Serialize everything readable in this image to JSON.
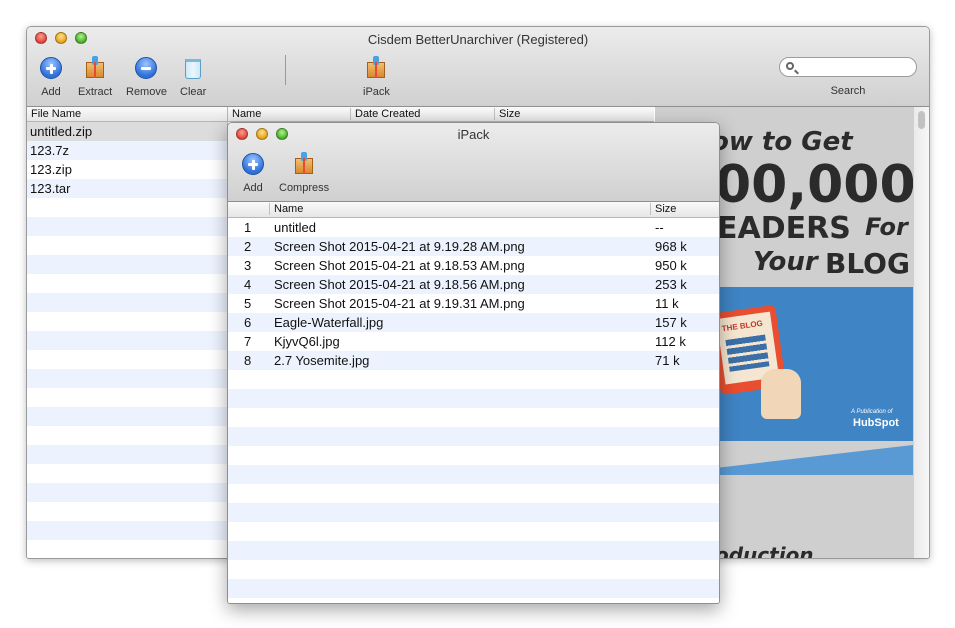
{
  "main_window": {
    "title": "Cisdem BetterUnarchiver (Registered)",
    "toolbar": {
      "add_label": "Add",
      "extract_label": "Extract",
      "remove_label": "Remove",
      "clear_label": "Clear",
      "ipack_label": "iPack",
      "search_label": "Search",
      "search_value": ""
    },
    "file_list": {
      "header": "File Name",
      "items": [
        "untitled.zip",
        "123.7z",
        "123.zip",
        "123.tar"
      ],
      "selected_index": 0
    },
    "contents_columns": [
      "Name",
      "Date Created",
      "Size"
    ],
    "preview": {
      "lines": [
        "ow to Get",
        "00,000",
        "EADERS",
        "For",
        "Your",
        "BLOG",
        "THE BLOG",
        "A Publication of",
        "HubSpot",
        "oduction"
      ]
    }
  },
  "ipack_window": {
    "title": "iPack",
    "toolbar": {
      "add_label": "Add",
      "compress_label": "Compress"
    },
    "columns": {
      "name": "Name",
      "size": "Size"
    },
    "rows": [
      {
        "index": "1",
        "name": "untitled",
        "size": "--"
      },
      {
        "index": "2",
        "name": "Screen Shot 2015-04-21 at 9.19.28 AM.png",
        "size": "968 k"
      },
      {
        "index": "3",
        "name": "Screen Shot 2015-04-21 at 9.18.53 AM.png",
        "size": "950 k"
      },
      {
        "index": "4",
        "name": "Screen Shot 2015-04-21 at 9.18.56 AM.png",
        "size": "253 k"
      },
      {
        "index": "5",
        "name": "Screen Shot 2015-04-21 at 9.19.31 AM.png",
        "size": "11 k"
      },
      {
        "index": "6",
        "name": "Eagle-Waterfall.jpg",
        "size": "157 k"
      },
      {
        "index": "7",
        "name": "KjyvQ6l.jpg",
        "size": "112 k"
      },
      {
        "index": "8",
        "name": "2.7 Yosemite.jpg",
        "size": "71 k"
      }
    ]
  }
}
